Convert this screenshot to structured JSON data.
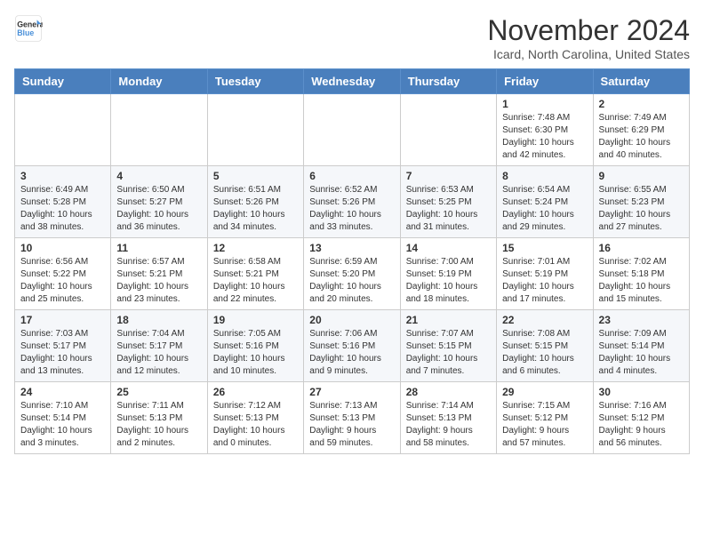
{
  "logo": {
    "line1": "General",
    "line2": "Blue"
  },
  "title": "November 2024",
  "subtitle": "Icard, North Carolina, United States",
  "days_header": [
    "Sunday",
    "Monday",
    "Tuesday",
    "Wednesday",
    "Thursday",
    "Friday",
    "Saturday"
  ],
  "weeks": [
    [
      {
        "day": "",
        "info": ""
      },
      {
        "day": "",
        "info": ""
      },
      {
        "day": "",
        "info": ""
      },
      {
        "day": "",
        "info": ""
      },
      {
        "day": "",
        "info": ""
      },
      {
        "day": "1",
        "info": "Sunrise: 7:48 AM\nSunset: 6:30 PM\nDaylight: 10 hours\nand 42 minutes."
      },
      {
        "day": "2",
        "info": "Sunrise: 7:49 AM\nSunset: 6:29 PM\nDaylight: 10 hours\nand 40 minutes."
      }
    ],
    [
      {
        "day": "3",
        "info": "Sunrise: 6:49 AM\nSunset: 5:28 PM\nDaylight: 10 hours\nand 38 minutes."
      },
      {
        "day": "4",
        "info": "Sunrise: 6:50 AM\nSunset: 5:27 PM\nDaylight: 10 hours\nand 36 minutes."
      },
      {
        "day": "5",
        "info": "Sunrise: 6:51 AM\nSunset: 5:26 PM\nDaylight: 10 hours\nand 34 minutes."
      },
      {
        "day": "6",
        "info": "Sunrise: 6:52 AM\nSunset: 5:26 PM\nDaylight: 10 hours\nand 33 minutes."
      },
      {
        "day": "7",
        "info": "Sunrise: 6:53 AM\nSunset: 5:25 PM\nDaylight: 10 hours\nand 31 minutes."
      },
      {
        "day": "8",
        "info": "Sunrise: 6:54 AM\nSunset: 5:24 PM\nDaylight: 10 hours\nand 29 minutes."
      },
      {
        "day": "9",
        "info": "Sunrise: 6:55 AM\nSunset: 5:23 PM\nDaylight: 10 hours\nand 27 minutes."
      }
    ],
    [
      {
        "day": "10",
        "info": "Sunrise: 6:56 AM\nSunset: 5:22 PM\nDaylight: 10 hours\nand 25 minutes."
      },
      {
        "day": "11",
        "info": "Sunrise: 6:57 AM\nSunset: 5:21 PM\nDaylight: 10 hours\nand 23 minutes."
      },
      {
        "day": "12",
        "info": "Sunrise: 6:58 AM\nSunset: 5:21 PM\nDaylight: 10 hours\nand 22 minutes."
      },
      {
        "day": "13",
        "info": "Sunrise: 6:59 AM\nSunset: 5:20 PM\nDaylight: 10 hours\nand 20 minutes."
      },
      {
        "day": "14",
        "info": "Sunrise: 7:00 AM\nSunset: 5:19 PM\nDaylight: 10 hours\nand 18 minutes."
      },
      {
        "day": "15",
        "info": "Sunrise: 7:01 AM\nSunset: 5:19 PM\nDaylight: 10 hours\nand 17 minutes."
      },
      {
        "day": "16",
        "info": "Sunrise: 7:02 AM\nSunset: 5:18 PM\nDaylight: 10 hours\nand 15 minutes."
      }
    ],
    [
      {
        "day": "17",
        "info": "Sunrise: 7:03 AM\nSunset: 5:17 PM\nDaylight: 10 hours\nand 13 minutes."
      },
      {
        "day": "18",
        "info": "Sunrise: 7:04 AM\nSunset: 5:17 PM\nDaylight: 10 hours\nand 12 minutes."
      },
      {
        "day": "19",
        "info": "Sunrise: 7:05 AM\nSunset: 5:16 PM\nDaylight: 10 hours\nand 10 minutes."
      },
      {
        "day": "20",
        "info": "Sunrise: 7:06 AM\nSunset: 5:16 PM\nDaylight: 10 hours\nand 9 minutes."
      },
      {
        "day": "21",
        "info": "Sunrise: 7:07 AM\nSunset: 5:15 PM\nDaylight: 10 hours\nand 7 minutes."
      },
      {
        "day": "22",
        "info": "Sunrise: 7:08 AM\nSunset: 5:15 PM\nDaylight: 10 hours\nand 6 minutes."
      },
      {
        "day": "23",
        "info": "Sunrise: 7:09 AM\nSunset: 5:14 PM\nDaylight: 10 hours\nand 4 minutes."
      }
    ],
    [
      {
        "day": "24",
        "info": "Sunrise: 7:10 AM\nSunset: 5:14 PM\nDaylight: 10 hours\nand 3 minutes."
      },
      {
        "day": "25",
        "info": "Sunrise: 7:11 AM\nSunset: 5:13 PM\nDaylight: 10 hours\nand 2 minutes."
      },
      {
        "day": "26",
        "info": "Sunrise: 7:12 AM\nSunset: 5:13 PM\nDaylight: 10 hours\nand 0 minutes."
      },
      {
        "day": "27",
        "info": "Sunrise: 7:13 AM\nSunset: 5:13 PM\nDaylight: 9 hours\nand 59 minutes."
      },
      {
        "day": "28",
        "info": "Sunrise: 7:14 AM\nSunset: 5:13 PM\nDaylight: 9 hours\nand 58 minutes."
      },
      {
        "day": "29",
        "info": "Sunrise: 7:15 AM\nSunset: 5:12 PM\nDaylight: 9 hours\nand 57 minutes."
      },
      {
        "day": "30",
        "info": "Sunrise: 7:16 AM\nSunset: 5:12 PM\nDaylight: 9 hours\nand 56 minutes."
      }
    ]
  ]
}
